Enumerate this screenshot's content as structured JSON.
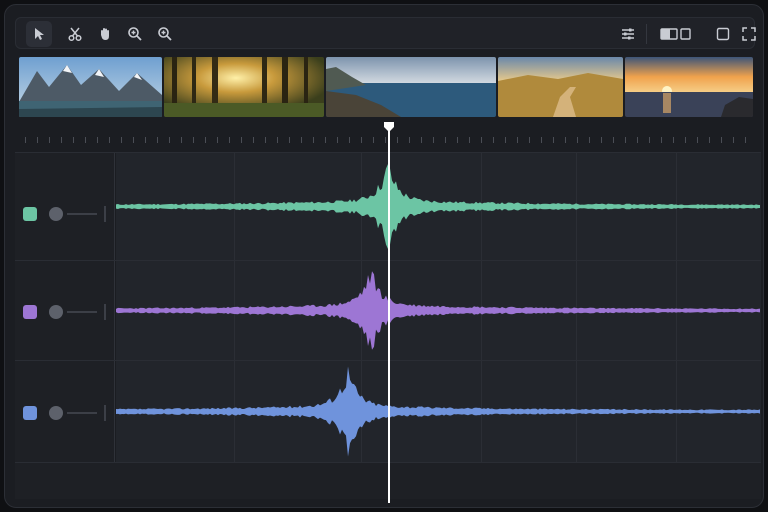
{
  "toolbar": {
    "left_tools": [
      {
        "name": "select-tool",
        "icon": "cursor-arrow-icon",
        "active": true
      },
      {
        "name": "cut-tool",
        "icon": "scissors-icon",
        "active": false
      },
      {
        "name": "hand-tool",
        "icon": "hand-icon",
        "active": false
      },
      {
        "name": "zoom-in-tool",
        "icon": "zoom-in-icon",
        "active": false
      },
      {
        "name": "zoom-out-tool",
        "icon": "zoom-out-icon",
        "active": false
      }
    ],
    "right_tools": [
      {
        "name": "settings-button",
        "icon": "sliders-icon"
      },
      {
        "name": "split-view-button",
        "icon": "split-view-icon"
      },
      {
        "name": "single-view-button",
        "icon": "single-view-icon"
      },
      {
        "name": "fullscreen-button",
        "icon": "fullscreen-icon"
      }
    ]
  },
  "filmstrip": {
    "thumbnails": [
      {
        "name": "mountain-lake",
        "sky": "#8fb3d6",
        "ground": "#3a5a63"
      },
      {
        "name": "forest-sunlight",
        "sky": "#d9b45a",
        "ground": "#3e4a22"
      },
      {
        "name": "ocean-coast",
        "sky": "#b9c9d8",
        "ground": "#2f5876"
      },
      {
        "name": "golden-field-path",
        "sky": "#d8b06a",
        "ground": "#a67b32"
      },
      {
        "name": "sunset-sea",
        "sky": "#e79a4e",
        "ground": "#3a4155"
      }
    ]
  },
  "tracks": [
    {
      "name": "track-1",
      "color": "#6cc5a4"
    },
    {
      "name": "track-2",
      "color": "#9d76d4"
    },
    {
      "name": "track-3",
      "color": "#6f93dc"
    }
  ],
  "colors": {
    "playhead": "#ffffff",
    "background": "#1b1d22"
  }
}
